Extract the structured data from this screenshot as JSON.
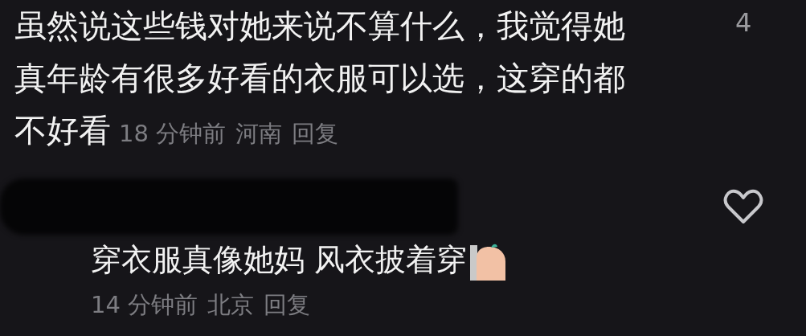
{
  "comments": [
    {
      "kind": "top",
      "lines": [
        "虽然说这些钱对她来说不算什么，我觉得她",
        "真年龄有很多好看的衣服可以选，这穿的都",
        "不好看"
      ],
      "time": "18 分钟前",
      "location": "河南",
      "reply": "回复",
      "likes": "4"
    },
    {
      "kind": "nested",
      "lines": [
        "穿衣服真像她妈 风衣披着穿"
      ],
      "time": "14 分钟前",
      "location": "北京",
      "reply": "回复",
      "sticker": true
    }
  ]
}
